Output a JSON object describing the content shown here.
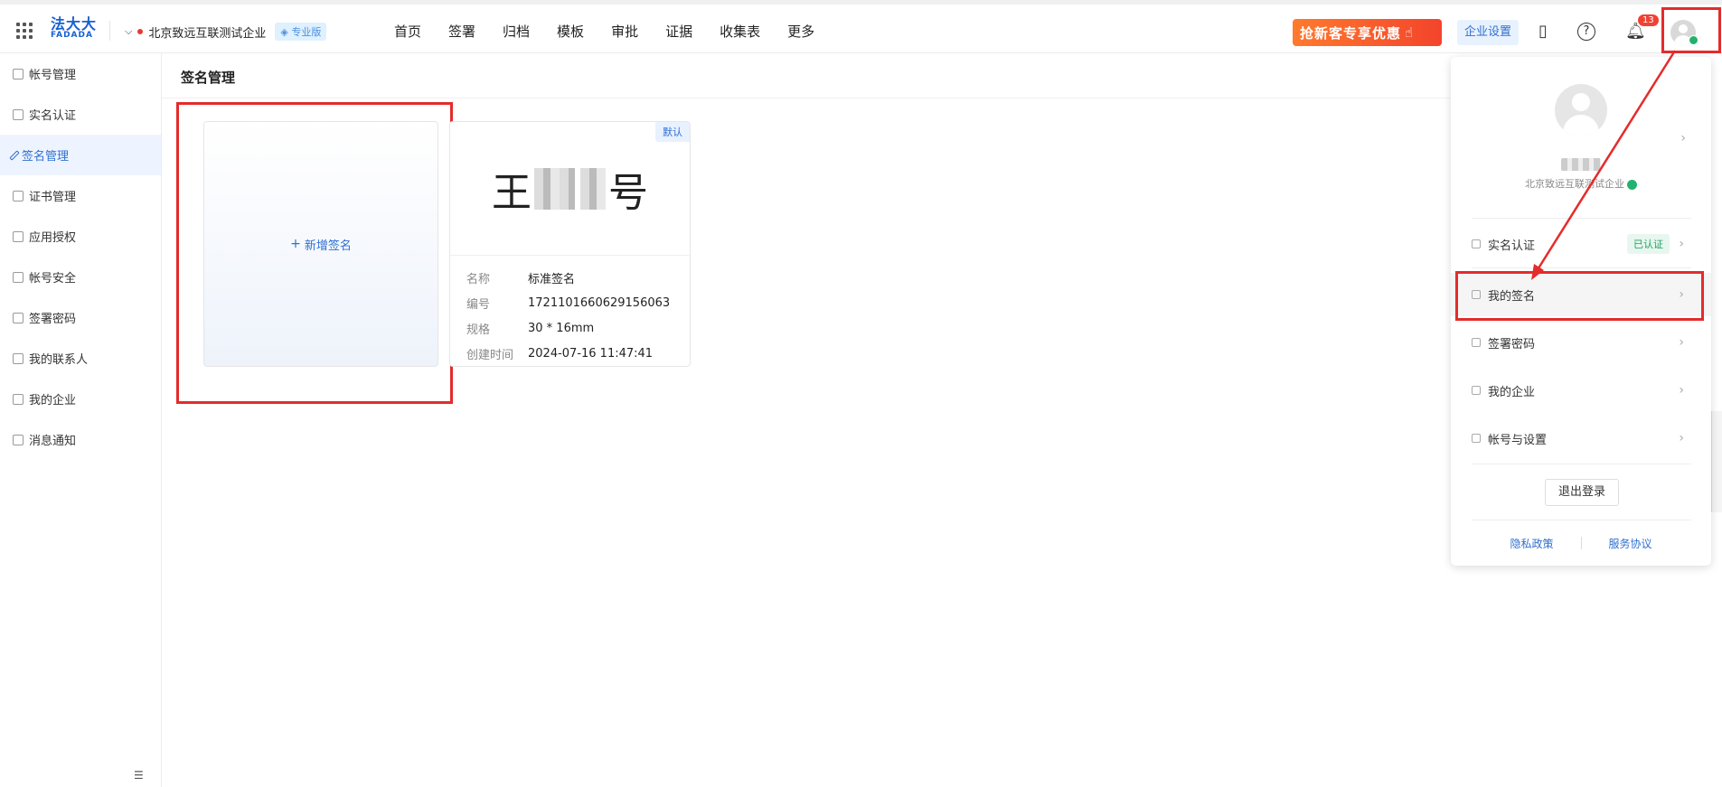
{
  "brand": {
    "logo_cn": "法大大",
    "logo_en": "FADADA"
  },
  "company_selector": {
    "name": "北京致远互联测试企业",
    "edition": "专业版"
  },
  "nav": [
    "首页",
    "签署",
    "归档",
    "模板",
    "审批",
    "证据",
    "收集表",
    "更多"
  ],
  "promo_label": "抢新客专享优惠",
  "enterprise_settings": "企业设置",
  "notifications": {
    "count": "13"
  },
  "sidebar": [
    {
      "label": "帐号管理"
    },
    {
      "label": "实名认证"
    },
    {
      "label": "签名管理",
      "active": true
    },
    {
      "label": "证书管理"
    },
    {
      "label": "应用授权"
    },
    {
      "label": "帐号安全"
    },
    {
      "label": "签署密码"
    },
    {
      "label": "我的联系人"
    },
    {
      "label": "我的企业"
    },
    {
      "label": "消息通知"
    }
  ],
  "main": {
    "title": "签名管理",
    "add_signature_label": "新增签名",
    "signature": {
      "default_tag": "默认",
      "preview_text_start": "王",
      "preview_text_end": "号",
      "fields": [
        {
          "key": "名称",
          "value": "标准签名"
        },
        {
          "key": "编号",
          "value": "1721101660629156063"
        },
        {
          "key": "规格",
          "value": "30 * 16mm"
        },
        {
          "key": "创建时间",
          "value": "2024-07-16 11:47:41"
        }
      ]
    }
  },
  "user_menu": {
    "company": "北京致远互联测试企业",
    "verification": {
      "label": "实名认证",
      "status": "已认证"
    },
    "items": [
      {
        "label": "我的签名"
      },
      {
        "label": "签署密码"
      },
      {
        "label": "我的企业"
      },
      {
        "label": "帐号与设置"
      }
    ],
    "logout": "退出登录",
    "links": [
      "隐私政策",
      "服务协议"
    ]
  },
  "colors": {
    "accent": "#2f6fd0",
    "annotation_red": "#e52b2b",
    "verified_green": "#23b26d",
    "badge_red": "#f04134"
  }
}
